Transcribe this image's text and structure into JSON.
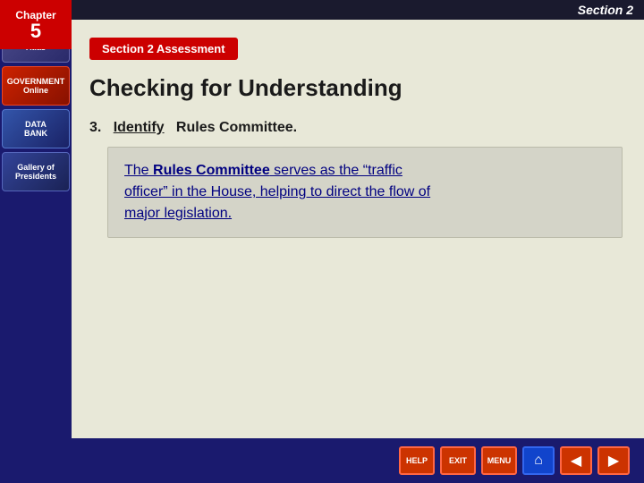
{
  "header": {
    "section_label": "Section 2"
  },
  "chapter": {
    "label": "Chapter",
    "number": "5"
  },
  "sidebar": {
    "items": [
      {
        "id": "reference-atlas",
        "label": "Reference\nAtlas"
      },
      {
        "id": "government-online",
        "label": "GOVERNMENT\nOnline"
      },
      {
        "id": "data-bank",
        "label": "DATA\nBANK"
      },
      {
        "id": "gallery-presidents",
        "label": "Gallery of\nPresidents"
      }
    ]
  },
  "main": {
    "assessment_banner": "Section 2 Assessment",
    "page_title": "Checking for Understanding",
    "question_number": "3.",
    "question_verb": "Identify",
    "question_text": "Rules Committee.",
    "answer_line1_pre": "The ",
    "answer_highlight": "Rules Committee",
    "answer_line1_post": " serves as the “traffic",
    "answer_line2": "officer” in the House, helping to direct the flow of",
    "answer_line3": "major legislation."
  },
  "toolbar": {
    "buttons": [
      {
        "id": "help",
        "label": "HELP"
      },
      {
        "id": "exit",
        "label": "EXIT"
      },
      {
        "id": "menu",
        "label": "MENU"
      }
    ],
    "nav": [
      {
        "id": "home",
        "symbol": "⌂"
      },
      {
        "id": "back",
        "symbol": "◀"
      },
      {
        "id": "forward",
        "symbol": "▶"
      }
    ]
  }
}
